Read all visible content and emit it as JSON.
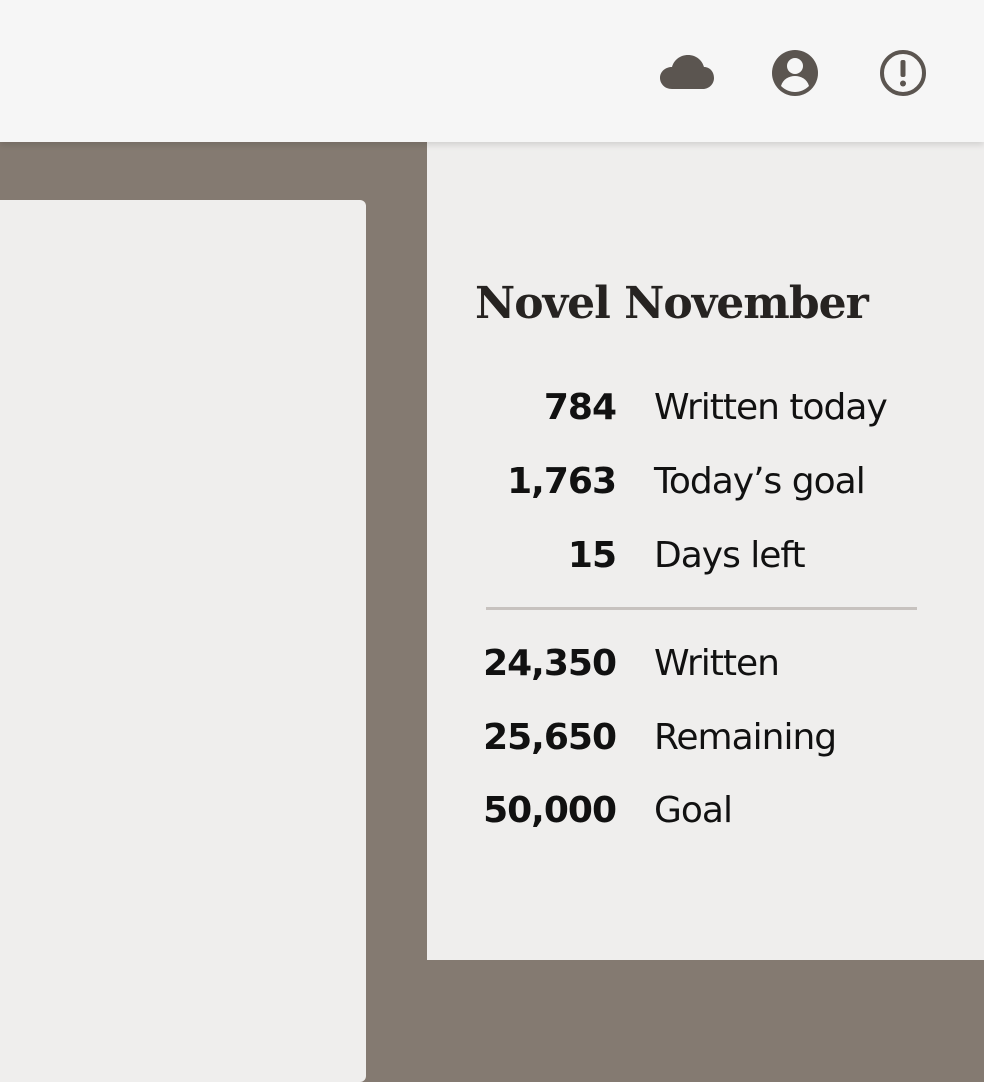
{
  "header": {
    "icons": [
      {
        "name": "cloud-icon"
      },
      {
        "name": "account-icon"
      },
      {
        "name": "alert-icon"
      }
    ]
  },
  "stats": {
    "title": "Novel November",
    "today": [
      {
        "value": "784",
        "label": "Written today"
      },
      {
        "value": "1,763",
        "label": "Today’s goal"
      },
      {
        "value": "15",
        "label": "Days left"
      }
    ],
    "overall": [
      {
        "value": "24,350",
        "label": "Written"
      },
      {
        "value": "25,650",
        "label": "Remaining"
      },
      {
        "value": "50,000",
        "label": "Goal"
      }
    ]
  },
  "colors": {
    "background": "#847a71",
    "panel": "#efeeed",
    "topbar": "#f6f6f6",
    "icon": "#5b5550",
    "text": "#111111",
    "divider": "#c7c2bf"
  }
}
